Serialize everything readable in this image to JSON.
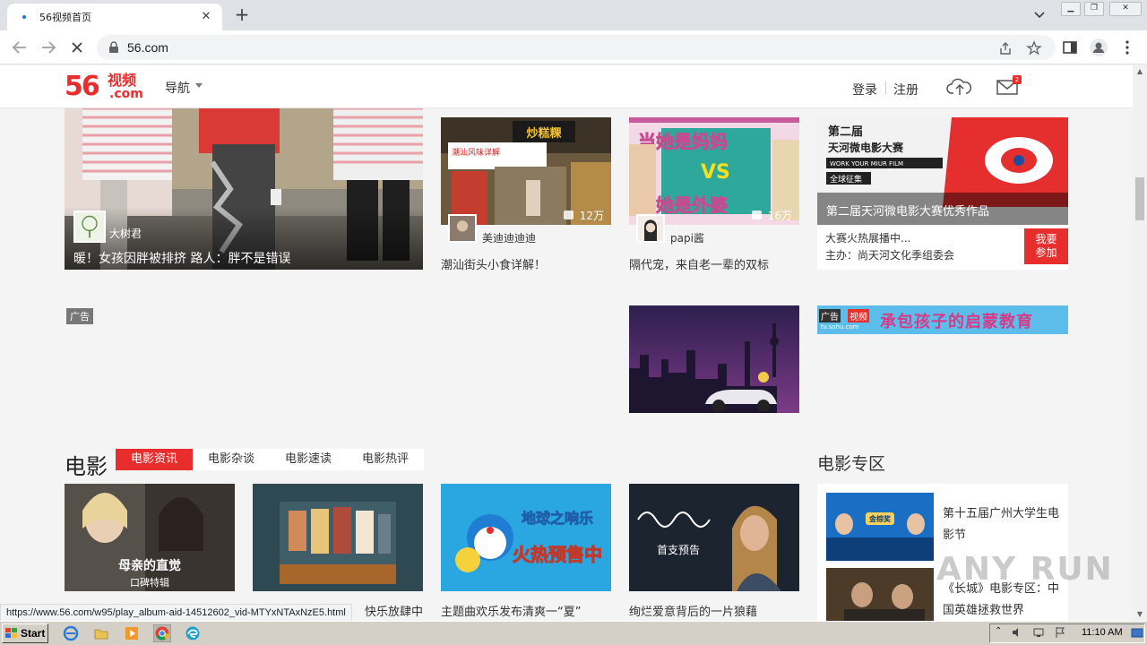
{
  "browser": {
    "tab_title": "56视频首页",
    "url": "56.com",
    "status_url": "https://www.56.com/w95/play_album-aid-14512602_vid-MTYxNTAxNzE5.html"
  },
  "site": {
    "logo_num": "56",
    "logo_cn": "视频",
    "logo_com": ".com",
    "nav_label": "导航",
    "login": "登录",
    "register": "注册",
    "mail_badge": "2"
  },
  "hero": {
    "user": "大树君",
    "title": "暖！女孩因胖被排挤 路人：胖不是错误"
  },
  "videos": [
    {
      "user": "美迪迪迪迪",
      "count": "12万",
      "title": "潮汕街头小食详解！"
    },
    {
      "user": "papi酱",
      "count": "16万",
      "title": "隔代宠，来自老一辈的双标"
    }
  ],
  "thumb_text": {
    "shop_sign": "炒糕粿",
    "shop_caption": "潮汕风味详解",
    "mom_line1": "当她是妈妈",
    "mom_vs": "VS",
    "mom_line2": "当她是外婆"
  },
  "contest": {
    "badge_line1": "第二届",
    "badge_line2": "天河微电影大赛",
    "badge_line3": "WORK YOUR MIUR FILM",
    "badge_line4": "全球征集",
    "caption": "第二届天河微电影大赛优秀作品",
    "line1": "大赛火热展播中...",
    "line2": "主办：尚天河文化季组委会",
    "join_line1": "我要",
    "join_line2": "参加"
  },
  "ads": {
    "label": "广告",
    "banner_label": "广告",
    "banner_tag": "视频",
    "banner_domain": "tv.sohu.com",
    "banner_text": "承包孩子的启蒙教育"
  },
  "movie_section": {
    "title": "电影",
    "tabs": [
      "电影资讯",
      "电影杂谈",
      "电影速读",
      "电影热评"
    ],
    "zone_title": "电影专区",
    "cards": [
      {
        "title": "",
        "overlay1": "母亲的直觉",
        "overlay2": "口碑特辑"
      },
      {
        "title": "快乐放肆中",
        "overlay1": "",
        "overlay2": ""
      },
      {
        "title": "主题曲欢乐发布清爽一“夏”",
        "overlay1": "地球之响乐",
        "overlay2": "火热预售中"
      },
      {
        "title": "绚烂爱意背后的一片狼藉",
        "overlay1": "首支预告",
        "overlay2": ""
      }
    ],
    "zone_items": [
      {
        "title": "第十五届广州大学生电影节",
        "badge": "金棕奖"
      },
      {
        "title": "《长城》电影专区：中国英雄拯救世界"
      }
    ]
  },
  "watermark": "ANY RUN",
  "taskbar": {
    "start": "Start",
    "clock": "11:10 AM"
  }
}
